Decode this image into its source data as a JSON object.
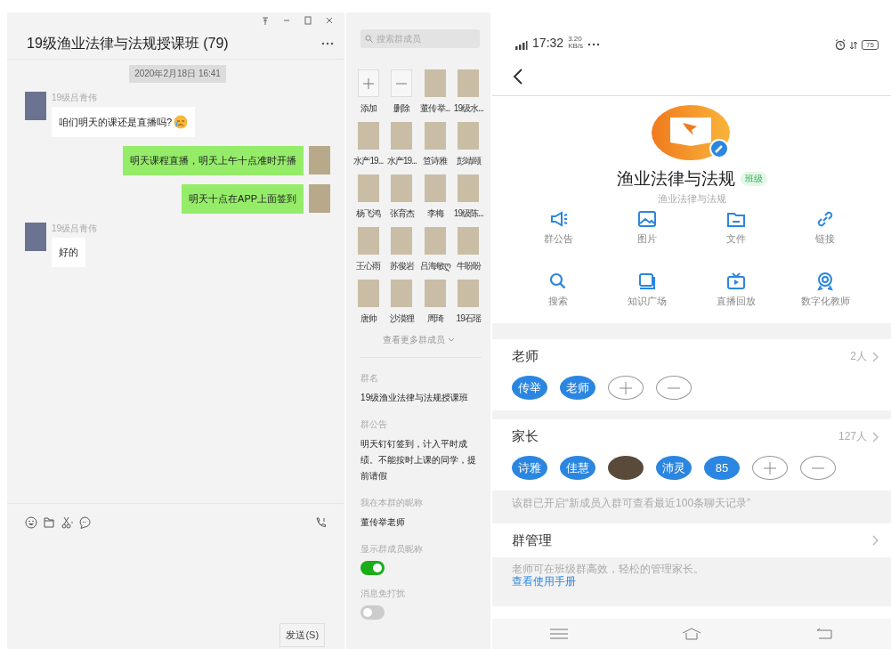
{
  "chat": {
    "title": "19级渔业法律与法规授课班 (79)",
    "timestamp": "2020年2月18日 16:41",
    "messages": [
      {
        "kind": "in",
        "sender": "19级吕青伟",
        "text": "咱们明天的课还是直播吗?",
        "emoji": true
      },
      {
        "kind": "out",
        "text": "明天课程直播，明天上午十点准时开播"
      },
      {
        "kind": "out",
        "text": "明天十点在APP上面签到"
      },
      {
        "kind": "in",
        "sender": "19级吕青伟",
        "text": "好的"
      }
    ],
    "send_button": "发送(S)"
  },
  "members": {
    "search_placeholder": "搜索群成员",
    "items": [
      {
        "kind": "add",
        "label": "添加"
      },
      {
        "kind": "remove",
        "label": "删除"
      },
      {
        "kind": "member",
        "label": "董传举..."
      },
      {
        "kind": "member",
        "label": "19级水..."
      },
      {
        "kind": "member",
        "label": "水产19..."
      },
      {
        "kind": "member",
        "label": "水产19..."
      },
      {
        "kind": "member",
        "label": "笪诗雅"
      },
      {
        "kind": "member",
        "label": "彭靖颐"
      },
      {
        "kind": "member",
        "label": "杨飞鸿"
      },
      {
        "kind": "member",
        "label": "张育杰"
      },
      {
        "kind": "member",
        "label": "李梅"
      },
      {
        "kind": "member",
        "label": "19级陈..."
      },
      {
        "kind": "member",
        "label": "王心雨"
      },
      {
        "kind": "member",
        "label": "苏俊岩"
      },
      {
        "kind": "member",
        "label": "吕海敏ღ"
      },
      {
        "kind": "member",
        "label": "牛盼盼"
      },
      {
        "kind": "member",
        "label": "唐帅"
      },
      {
        "kind": "member",
        "label": "沙漠狸"
      },
      {
        "kind": "member",
        "label": "周琦"
      },
      {
        "kind": "member",
        "label": "19石瑶"
      }
    ],
    "more": "查看更多群成员",
    "fields": [
      {
        "label": "群名",
        "value": "19级渔业法律与法规授课班"
      },
      {
        "label": "群公告",
        "value": "明天钉钉签到，计入平时成绩。不能按时上课的同学，提前请假"
      },
      {
        "label": "我在本群的昵称",
        "value": "董传举老师"
      }
    ],
    "toggles": [
      {
        "label": "显示群成员昵称",
        "on": true
      },
      {
        "label": "消息免打扰",
        "on": false
      }
    ]
  },
  "phone": {
    "status": {
      "time": "17:32",
      "speed": "3.20",
      "speed_unit": "KB/s",
      "battery": "75"
    },
    "group": {
      "name": "渔业法律与法规",
      "badge": "班级",
      "subtitle": "渔业法律与法规"
    },
    "features": [
      {
        "label": "群公告"
      },
      {
        "label": "图片"
      },
      {
        "label": "文件"
      },
      {
        "label": "链接"
      },
      {
        "label": "搜索"
      },
      {
        "label": "知识广场"
      },
      {
        "label": "直播回放"
      },
      {
        "label": "数字化教师"
      }
    ],
    "sections": [
      {
        "title": "老师",
        "count": "2人",
        "chips": [
          {
            "kind": "name",
            "label": "传举"
          },
          {
            "kind": "name",
            "label": "老师"
          },
          {
            "kind": "add"
          },
          {
            "kind": "remove"
          }
        ]
      },
      {
        "title": "家长",
        "count": "127人",
        "chips": [
          {
            "kind": "name",
            "label": "诗雅"
          },
          {
            "kind": "name",
            "label": "佳慧"
          },
          {
            "kind": "photo"
          },
          {
            "kind": "name",
            "label": "沛灵"
          },
          {
            "kind": "name",
            "label": "85"
          },
          {
            "kind": "add"
          },
          {
            "kind": "remove"
          }
        ]
      }
    ],
    "notice": "该群已开启“新成员入群可查看最近100条聊天记录”",
    "manage": {
      "title": "群管理",
      "hint": "老师可在班级群高效，轻松的管理家长。",
      "link": "查看使用手册"
    }
  }
}
